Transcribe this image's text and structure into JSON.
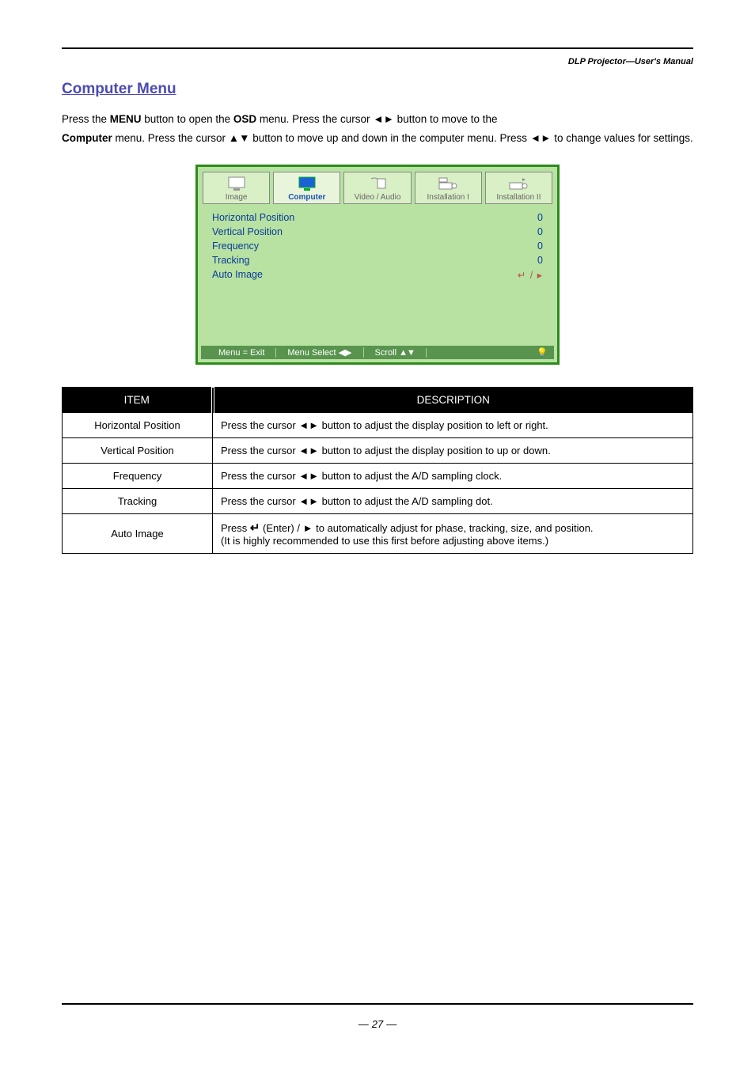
{
  "header": {
    "title_right": "DLP Projector—User's Manual"
  },
  "section_title": "Computer Menu",
  "intro": {
    "line1_a": "Press the ",
    "line1_b": "MENU",
    "line1_c": " button to open the ",
    "line1_d": "OSD",
    "line1_e": " menu. Press the cursor ◄► button to move to the ",
    "line2_a": "Computer",
    "line2_b": " menu. Press the cursor ▲▼ button to move up and down in the computer menu. Press ◄► to change values for settings."
  },
  "osd": {
    "tabs": {
      "image": "Image",
      "computer": "Computer",
      "video_audio": "Video / Audio",
      "install1": "Installation I",
      "install2": "Installation II"
    },
    "rows": {
      "hpos": {
        "label": "Horizontal Position",
        "value": "0"
      },
      "vpos": {
        "label": "Vertical Position",
        "value": "0"
      },
      "freq": {
        "label": "Frequency",
        "value": "0"
      },
      "track": {
        "label": "Tracking",
        "value": "0"
      },
      "auto": {
        "label": "Auto Image",
        "value": "↵ / ▸"
      }
    },
    "footer": {
      "exit": "Menu = Exit",
      "select": "Menu Select ◀▶",
      "scroll_label": "Scroll",
      "bulb": "💡"
    }
  },
  "table": {
    "head_item": "ITEM",
    "head_desc": "DESCRIPTION",
    "rows": {
      "hpos": {
        "label": "Horizontal Position",
        "desc_a": "Press the cursor ◄► button to adjust the display position to left or right."
      },
      "vpos": {
        "label": "Vertical Position",
        "desc_a": "Press the cursor ◄► button to adjust the display position to up or down."
      },
      "freq": {
        "label": "Frequency",
        "desc_a": "Press the cursor ◄► button to adjust the A/D sampling clock."
      },
      "track": {
        "label": "Tracking",
        "desc_a": "Press the cursor ◄► button to adjust the A/D sampling dot."
      },
      "auto": {
        "label": "Auto Image",
        "desc_a": "Press ",
        "desc_b": " (Enter) / ► to automatically adjust for phase, tracking, size, and position.",
        "note": "(It is highly recommended to use this first before adjusting above items.)"
      }
    }
  },
  "page_number": "27"
}
